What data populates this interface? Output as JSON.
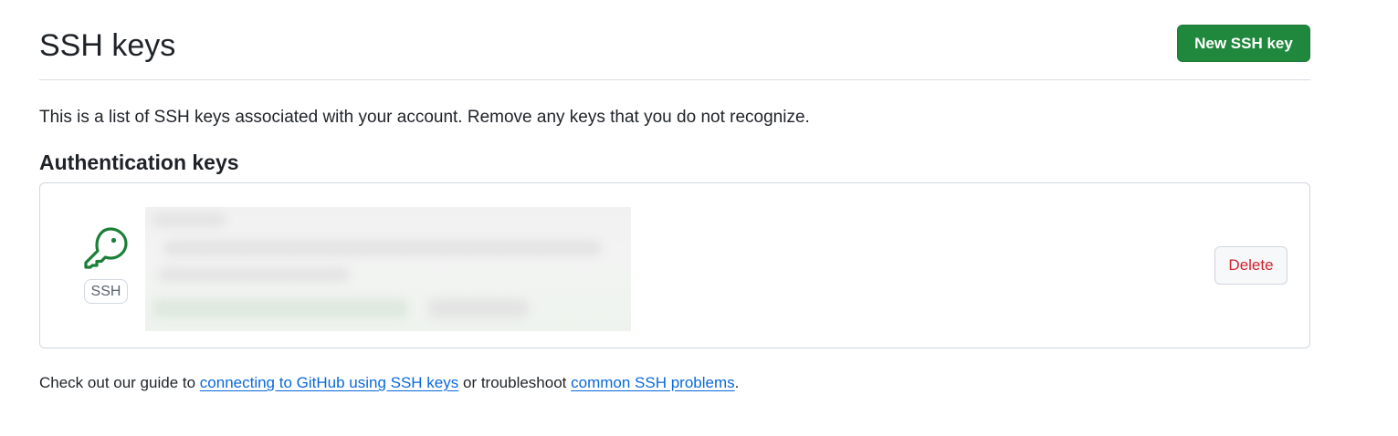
{
  "header": {
    "title": "SSH keys",
    "new_key_button": "New SSH key"
  },
  "description": "This is a list of SSH keys associated with your account. Remove any keys that you do not recognize.",
  "section": {
    "title": "Authentication keys"
  },
  "key_entry": {
    "icon": "key-icon",
    "type_label": "SSH",
    "delete_button": "Delete"
  },
  "footer": {
    "prefix": "Check out our guide to ",
    "link1": "connecting to GitHub using SSH keys",
    "middle": " or troubleshoot ",
    "link2": "common SSH problems",
    "suffix": "."
  },
  "colors": {
    "primary_button": "#1f883d",
    "danger_text": "#d1242f",
    "link": "#0969da",
    "key_icon": "#1a7f37"
  }
}
